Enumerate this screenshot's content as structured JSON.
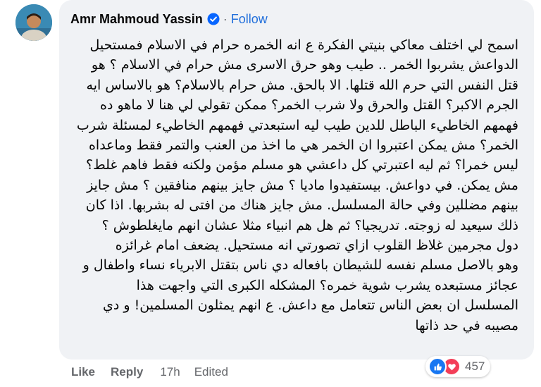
{
  "comment": {
    "author": "Amr Mahmoud Yassin",
    "follow_label": "Follow",
    "separator": "·",
    "lines": [
      "اسمح لي اختلف معاكي بنيتي الفكرة ع انه الخمره حرام في الاسلام فمستحيل",
      "الدواعش يشربوا الخمر .. طيب وهو حرق الاسرى مش حرام في الاسلام ؟ هو",
      "قتل النفس التي حرم الله قتلها. الا بالحق. مش حرام بالاسلام؟ هو بالاساس ايه",
      "الجرم الاكبر؟ القتل والحرق ولا شرب الخمر؟ ممكن تقولي لي هنا لا ماهو ده",
      "فهمهم الخاطيء الباطل للدين طيب ليه استبعدتي فهمهم الخاطيء لمسئلة شرب",
      "الخمر؟ مش يمكن اعتبروا ان الخمر هي ما اخذ من العنب والتمر فقط وماعداه",
      "ليس خمرا؟ ثم ليه اعتبرتي كل داعشي هو مسلم مؤمن ولكنه فقط فاهم غلط؟",
      "مش يمكن. في دواعش. بيستفيدوا ماديا ؟ مش جايز بينهم منافقين ؟ مش جايز",
      "بينهم مضللين وفي حالة المسلسل. مش جايز هناك من افتى له بشربها. اذا كان",
      "ذلك سيعيد له زوجته. تدريجيا؟ ثم هل هم انبياء مثلا عشان انهم مايغلطوش ؟",
      "دول مجرمين غلاظ القلوب ازاي تصورتي انه مستحيل. يضعف امام غرائزه",
      "وهو بالاصل مسلم نفسه للشيطان بافعاله دي ناس بتقتل الابرياء نساء واطفال و",
      "عجائز مستبعده يشرب شوية خمره؟ المشكله الكبرى التي واجهت هذا",
      "المسلسل ان بعض الناس تتعامل مع داعش. ع انهم يمثلون المسلمين! و دي",
      "مصيبه في حد ذاتها"
    ]
  },
  "actions": {
    "like_label": "Like",
    "reply_label": "Reply",
    "time": "17h",
    "edited_label": "Edited"
  },
  "reactions": {
    "types": [
      "like-icon",
      "love-icon"
    ],
    "count": "457",
    "like_color": "#1877f2",
    "love_color": "#f33e58"
  },
  "colors": {
    "bubble": "#f0f2f5",
    "follow": "#216fdb",
    "muted": "#65676b",
    "verified": "#0866ff"
  }
}
